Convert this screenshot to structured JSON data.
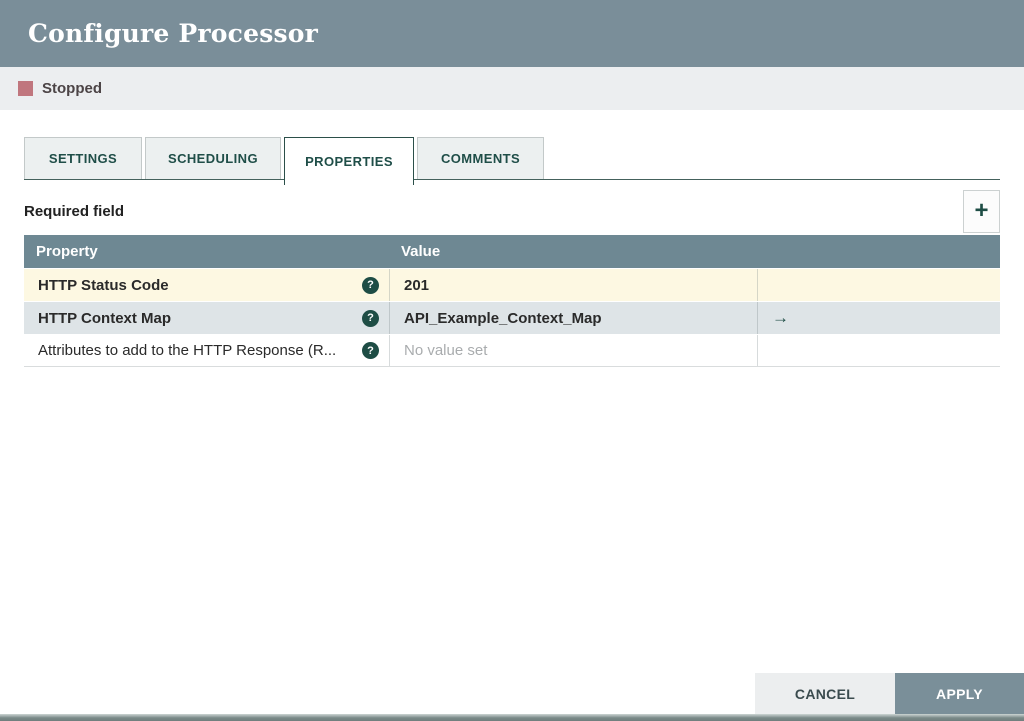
{
  "dialog": {
    "title": "Configure Processor"
  },
  "status": {
    "label": "Stopped",
    "swatch_color": "#c0767e"
  },
  "tabs": [
    {
      "label": "SETTINGS"
    },
    {
      "label": "SCHEDULING"
    },
    {
      "label": "PROPERTIES"
    },
    {
      "label": "COMMENTS"
    }
  ],
  "properties_panel": {
    "required_label": "Required field",
    "add_icon": "+",
    "table": {
      "property_header": "Property",
      "value_header": "Value",
      "rows": [
        {
          "property": "HTTP Status Code",
          "help_icon": "?",
          "value": "201",
          "state": "modified"
        },
        {
          "property": "HTTP Context Map",
          "help_icon": "?",
          "value": "API_Example_Context_Map",
          "goto_icon": "→",
          "state": "selected"
        },
        {
          "property": "Attributes to add to the HTTP Response (R...",
          "help_icon": "?",
          "value": "No value set",
          "state": "unset"
        }
      ]
    }
  },
  "footer": {
    "cancel_label": "CANCEL",
    "apply_label": "APPLY"
  },
  "colors": {
    "accent_teal": "#1e4d45",
    "dialog_header_bg": "#7a8e99",
    "table_header_bg": "#6e8893",
    "modified_row_bg": "#fdf8e2",
    "selected_row_bg": "#dee4e7",
    "stopped_swatch": "#c0767e"
  }
}
